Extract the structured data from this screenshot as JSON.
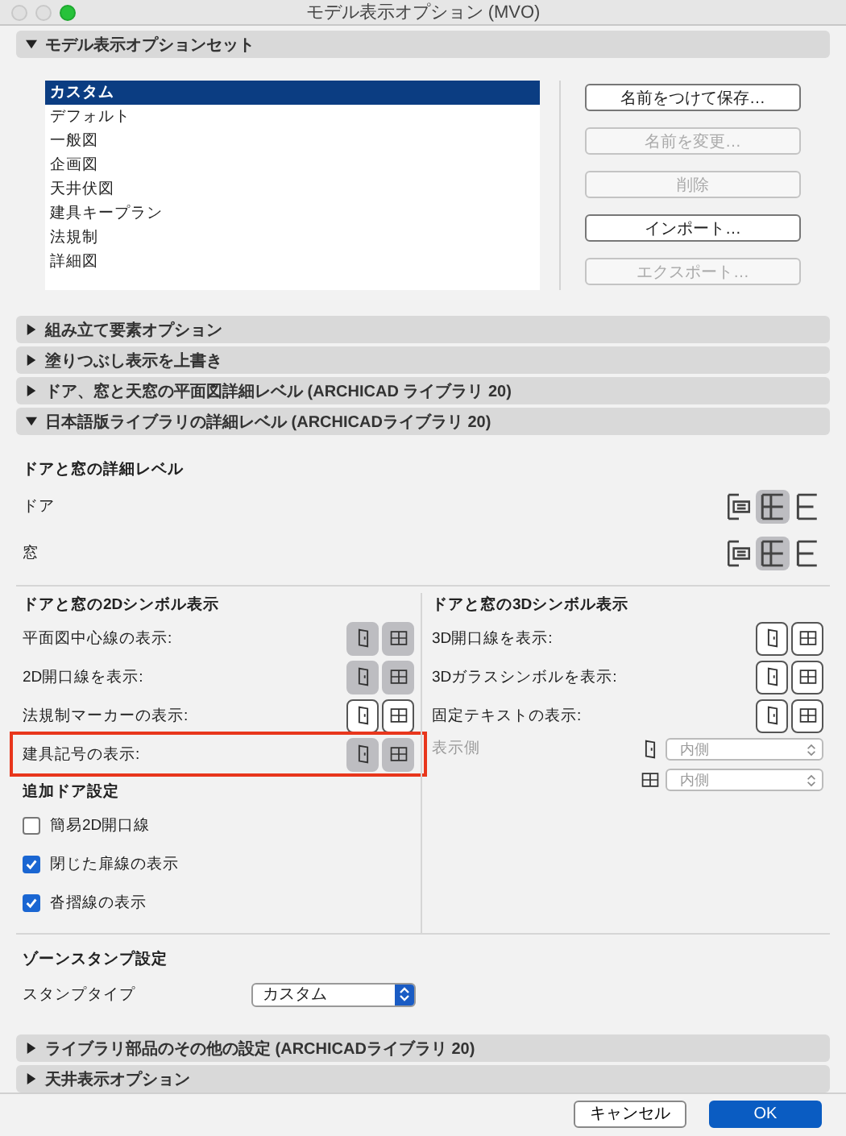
{
  "window": {
    "title": "モデル表示オプション (MVO)"
  },
  "mvo_set": {
    "title": "モデル表示オプションセット",
    "expanded": true,
    "items": [
      {
        "label": "カスタム",
        "selected": true
      },
      {
        "label": "デフォルト",
        "selected": false
      },
      {
        "label": "一般図",
        "selected": false
      },
      {
        "label": "企画図",
        "selected": false
      },
      {
        "label": "天井伏図",
        "selected": false
      },
      {
        "label": "建具キープラン",
        "selected": false
      },
      {
        "label": "法規制",
        "selected": false
      },
      {
        "label": "詳細図",
        "selected": false
      }
    ],
    "buttons": [
      {
        "label": "名前をつけて保存…",
        "disabled": false
      },
      {
        "label": "名前を変更…",
        "disabled": true
      },
      {
        "label": "削除",
        "disabled": true
      },
      {
        "label": "インポート…",
        "disabled": false
      },
      {
        "label": "エクスポート…",
        "disabled": true
      }
    ]
  },
  "sections_before": [
    {
      "title": "組み立て要素オプション",
      "expanded": false
    },
    {
      "title": "塗りつぶし表示を上書き",
      "expanded": false
    },
    {
      "title": "ドア、窓と天窓の平面図詳細レベル (ARCHICAD ライブラリ 20)",
      "expanded": false
    }
  ],
  "library_section": {
    "title": "日本語版ライブラリの詳細レベル (ARCHICADライブラリ 20)",
    "expanded": true,
    "detail_level": {
      "title": "ドアと窓の詳細レベル",
      "rows": [
        {
          "label": "ドア",
          "options": [
            {
              "selected": false
            },
            {
              "selected": true
            },
            {
              "selected": false
            }
          ]
        },
        {
          "label": "窓",
          "options": [
            {
              "selected": false
            },
            {
              "selected": true
            },
            {
              "selected": false
            }
          ]
        }
      ]
    },
    "symbol_2d": {
      "title": "ドアと窓の2Dシンボル表示",
      "rows": [
        {
          "label": "平面図中心線の表示:",
          "door": true,
          "window": true,
          "highlighted": false
        },
        {
          "label": "2D開口線を表示:",
          "door": true,
          "window": true,
          "highlighted": false
        },
        {
          "label": "法規制マーカーの表示:",
          "door": false,
          "window": false,
          "highlighted": false
        },
        {
          "label": "建具記号の表示:",
          "door": true,
          "window": true,
          "highlighted": true
        }
      ]
    },
    "extra_door": {
      "title": "追加ドア設定",
      "checkboxes": [
        {
          "label": "簡易2D開口線",
          "checked": false
        },
        {
          "label": "閉じた扉線の表示",
          "checked": true
        },
        {
          "label": "沓摺線の表示",
          "checked": true
        }
      ]
    },
    "symbol_3d": {
      "title": "ドアと窓の3Dシンボル表示",
      "rows": [
        {
          "label": "3D開口線を表示:",
          "door": false,
          "window": false,
          "highlighted": false
        },
        {
          "label": "3Dガラスシンボルを表示:",
          "door": false,
          "window": false,
          "highlighted": false
        },
        {
          "label": "固定テキストの表示:",
          "door": false,
          "window": false,
          "highlighted": false
        }
      ],
      "display_side": {
        "label": "表示側",
        "disabled": true,
        "selects": [
          {
            "kind": "door",
            "value": "内側"
          },
          {
            "kind": "window",
            "value": "内側"
          }
        ]
      }
    },
    "zone_stamp": {
      "title": "ゾーンスタンプ設定",
      "label": "スタンプタイプ",
      "value": "カスタム"
    }
  },
  "sections_after": [
    {
      "title": "ライブラリ部品のその他の設定 (ARCHICADライブラリ 20)",
      "expanded": false
    },
    {
      "title": "天井表示オプション",
      "expanded": false
    }
  ],
  "buttons": [
    {
      "label": "キャンセル",
      "kind": "secondary"
    },
    {
      "label": "OK",
      "kind": "default"
    }
  ]
}
